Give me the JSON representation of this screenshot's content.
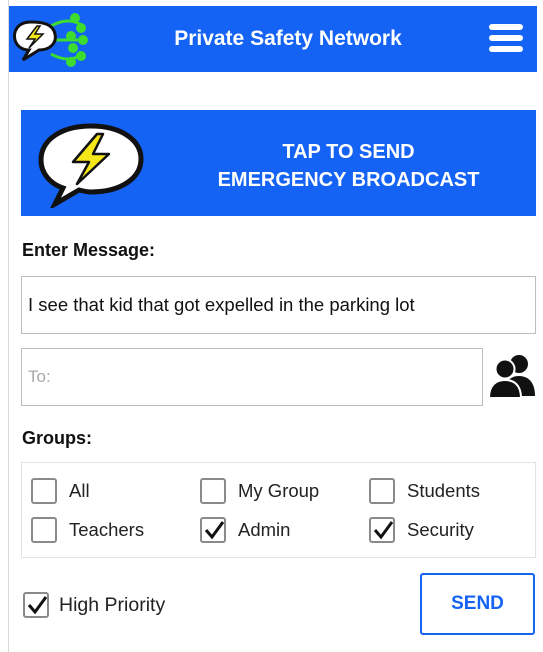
{
  "header": {
    "title": "Private Safety Network",
    "logo_icon": "lightning-speech-bubble-icon",
    "menu_icon": "hamburger-menu-icon"
  },
  "broadcast": {
    "line1": "TAP TO SEND",
    "line2": "EMERGENCY BROADCAST",
    "icon": "lightning-speech-bubble-icon"
  },
  "message": {
    "label": "Enter Message:",
    "value": "I see that kid that got expelled in the parking lot"
  },
  "recipient": {
    "placeholder": "To:",
    "icon": "contacts-icon"
  },
  "groups": {
    "label": "Groups:",
    "items": [
      {
        "label": "All",
        "checked": false
      },
      {
        "label": "My Group",
        "checked": false
      },
      {
        "label": "Students",
        "checked": false
      },
      {
        "label": "Teachers",
        "checked": false
      },
      {
        "label": "Admin",
        "checked": true
      },
      {
        "label": "Security",
        "checked": true
      }
    ]
  },
  "priority": {
    "label": "High Priority",
    "checked": true
  },
  "send_label": "SEND",
  "colors": {
    "brand_blue": "#1463f5",
    "logo_green": "#3ddc2e",
    "bolt_yellow": "#f5e61a"
  }
}
